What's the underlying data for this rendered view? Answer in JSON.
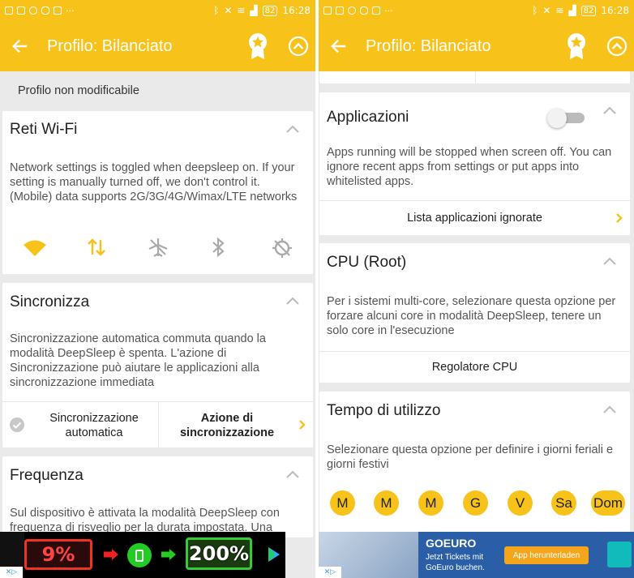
{
  "status": {
    "time": "16:28",
    "battery": "82"
  },
  "left": {
    "title": "Profilo: Bilanciato",
    "notice": "Profilo non modificabile",
    "wifi": {
      "title": "Reti Wi-Fi",
      "desc": "Network settings is toggled when deepsleep on. If your setting is manually turned off, we don't control it. (Mobile) data supports 2G/3G/4G/Wimax/LTE networks",
      "icons": [
        "wifi-icon",
        "mobile-data-icon",
        "airplane-icon",
        "bluetooth-icon",
        "sync-off-icon"
      ]
    },
    "sync": {
      "title": "Sincronizza",
      "desc": "Sincronizzazione automatica commuta quando la modalità DeepSleep è spenta. L'azione di Sincronizzazione può aiutare le applicazioni alla sincronizzazione immediata",
      "auto_label_1": "Sincronizzazione",
      "auto_label_2": "automatica",
      "action_label_1": "Azione di",
      "action_label_2": "sincronizzazione"
    },
    "freq": {
      "title": "Frequenza",
      "desc": "Sul dispositivo è attivata la modalità DeepSleep con frequenza di risveglio per la durata impostata. Una"
    },
    "ad": {
      "percent_low": "9%",
      "percent_high": "200%"
    }
  },
  "right": {
    "title": "Profilo: Bilanciato",
    "apps": {
      "title": "Applicazioni",
      "desc": "Apps running will be stopped when screen off. You can ignore recent apps from settings or put apps into whitelisted apps.",
      "link": "Lista applicazioni ignorate"
    },
    "cpu": {
      "title": "CPU (Root)",
      "desc": "Per i sistemi multi-core, selezionare questa opzione per forzare alcuni core in modalità DeepSleep, tenere un solo core in l'esecuzione",
      "link": "Regolatore CPU"
    },
    "time": {
      "title": "Tempo di utilizzo",
      "desc": "Selezionare questa opzione per definire i giorni feriali e giorni festivi",
      "days": [
        "M",
        "M",
        "M",
        "G",
        "V",
        "Sa",
        "Dom"
      ]
    },
    "ad": {
      "brand": "GOEURO",
      "line1": "Jetzt Tickets mit",
      "line2": "GoEuro buchen.",
      "button": "App herunterladen"
    }
  },
  "colors": {
    "accent": "#f7c21a",
    "card": "#ffffff",
    "bg": "#eaeaea"
  }
}
